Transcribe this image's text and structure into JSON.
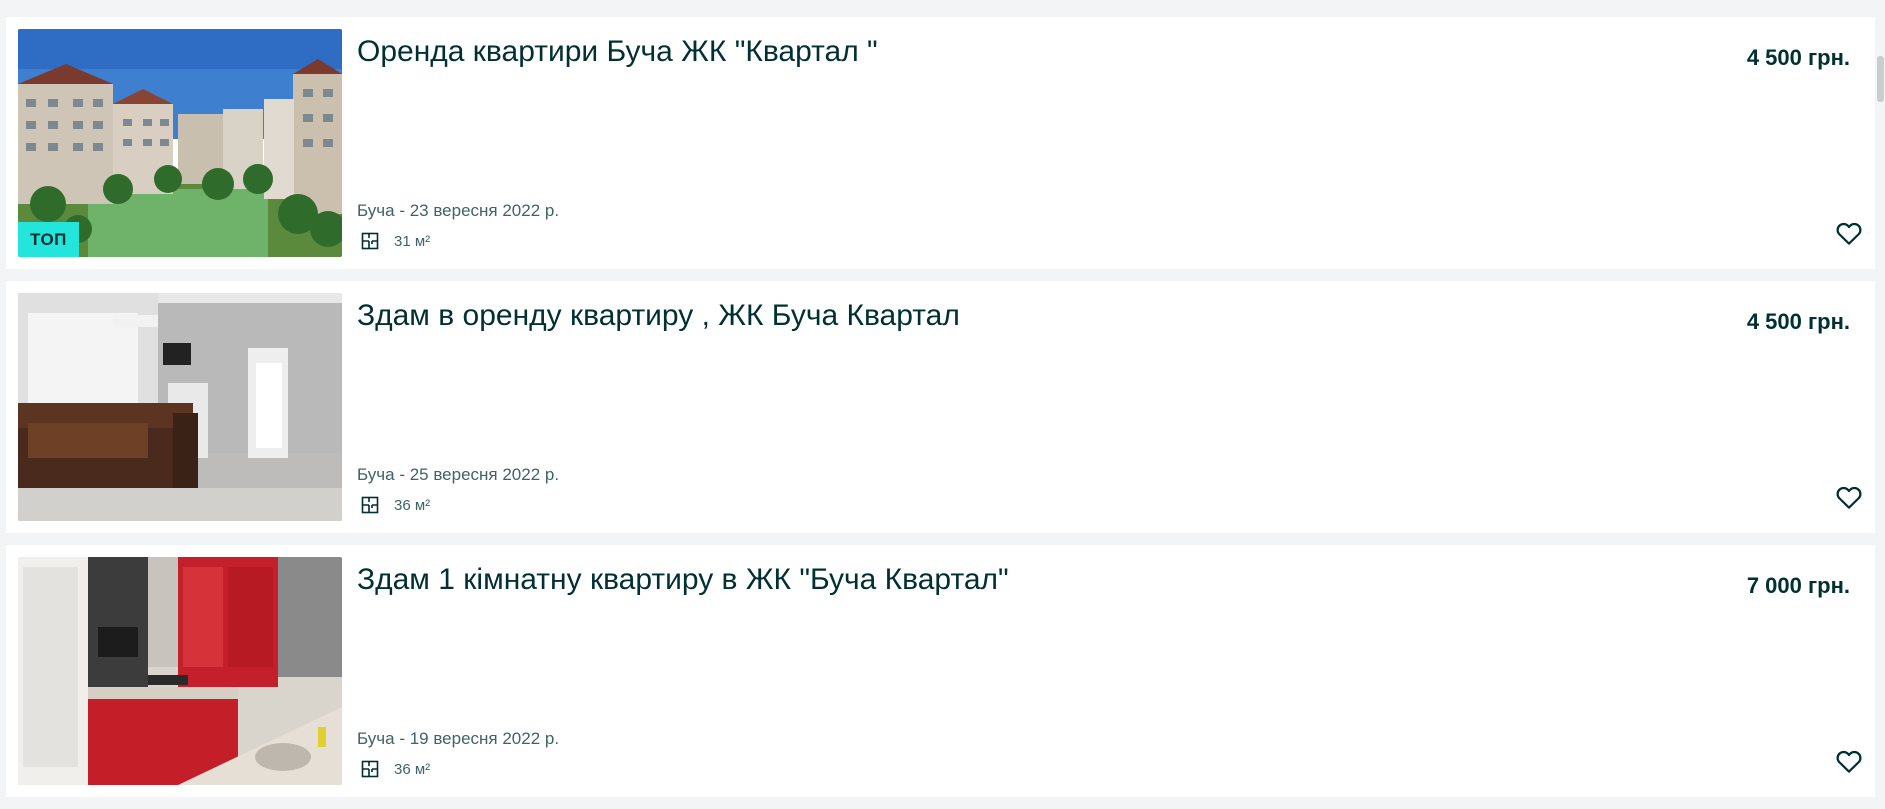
{
  "listings": [
    {
      "title": "Оренда квартири Буча ЖК \"Квартал \"",
      "price": "4 500 грн.",
      "location_date": "Буча - 23 вересня 2022 р.",
      "area": "31 м²",
      "badge": "ТОП",
      "photo": "apartment-buildings-courtyard",
      "favorite_icon": "heart-outline-icon"
    },
    {
      "title": "Здам в оренду квартиру , ЖК Буча Квартал",
      "price": "4 500 грн.",
      "location_date": "Буча - 25 вересня 2022 р.",
      "area": "36 м²",
      "photo": "living-room-with-sofa",
      "favorite_icon": "heart-outline-icon"
    },
    {
      "title": "Здам 1 кімнатну квартиру в ЖК \"Буча Квартал\"",
      "price": "7 000 грн.",
      "location_date": "Буча - 19 вересня 2022 р.",
      "area": "36 м²",
      "photo": "red-kitchen",
      "favorite_icon": "heart-outline-icon"
    }
  ],
  "colors": {
    "page_background": "#f2f4f5",
    "card_background": "#ffffff",
    "text_primary": "#002f34",
    "text_secondary": "#406367",
    "top_badge": "#23e5db"
  }
}
